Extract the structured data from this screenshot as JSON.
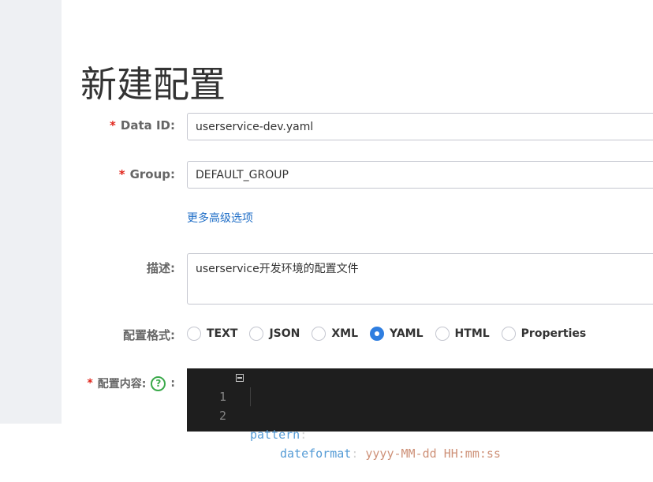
{
  "page": {
    "title": "新建配置"
  },
  "form": {
    "required_mark": "*",
    "data_id": {
      "label": "Data ID:",
      "value": "userservice-dev.yaml"
    },
    "group": {
      "label": "Group:",
      "value": "DEFAULT_GROUP"
    },
    "advanced_link": "更多高级选项",
    "description": {
      "label": "描述:",
      "value": "userservice开发环境的配置文件"
    },
    "format": {
      "label": "配置格式:",
      "options": [
        "TEXT",
        "JSON",
        "XML",
        "YAML",
        "HTML",
        "Properties"
      ],
      "selected": "YAML"
    },
    "content": {
      "label": "配置内容:",
      "help_icon": "?",
      "colon": ":"
    }
  },
  "editor": {
    "lines": [
      {
        "number": "1",
        "key": "pattern",
        "sep": ":",
        "value": ""
      },
      {
        "number": "2",
        "key": "dateformat",
        "sep": ": ",
        "value": "yyyy-MM-dd HH:mm:ss"
      }
    ]
  },
  "colors": {
    "accent": "#2f7ee0",
    "link": "#1f6ec7",
    "required": "#e1251b",
    "help": "#3aa94a",
    "editor_bg": "#1e1e1e"
  }
}
